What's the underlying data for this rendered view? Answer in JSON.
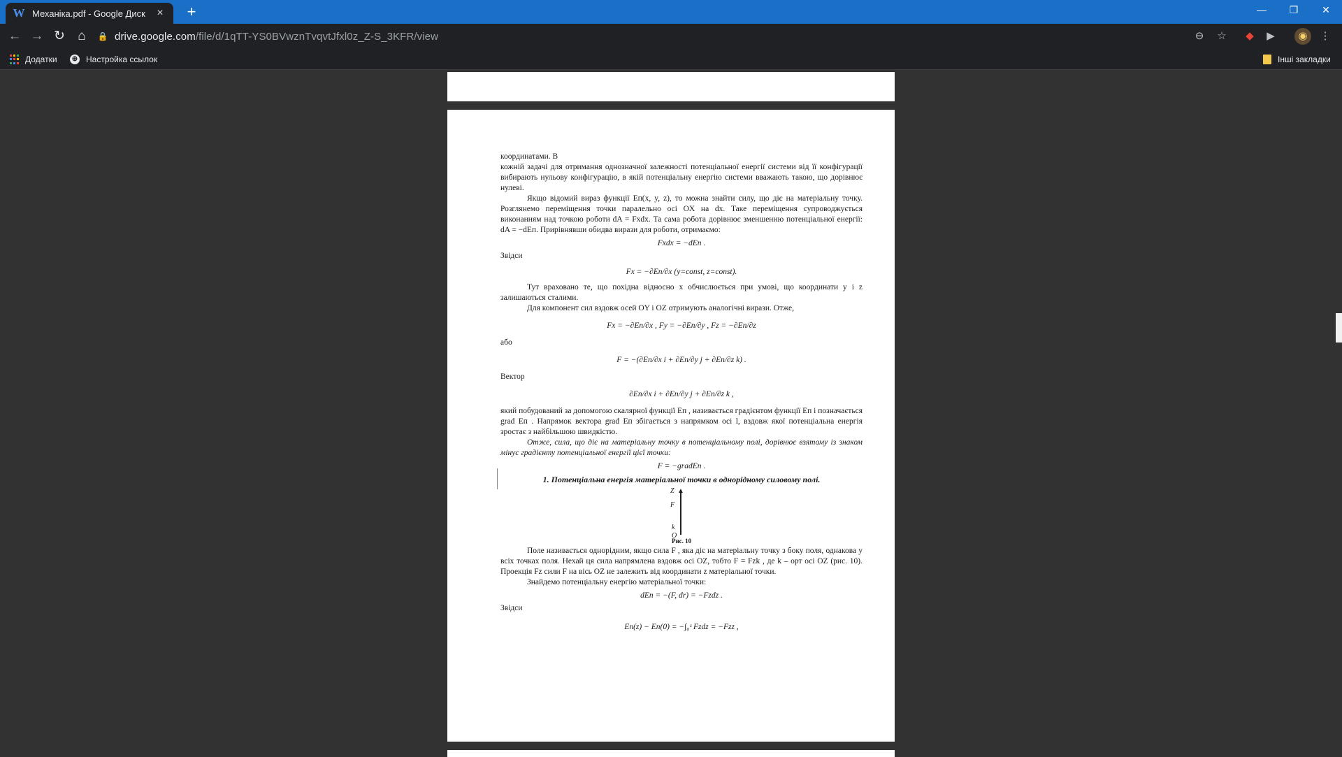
{
  "browser": {
    "tab_title": "Механіка.pdf - Google Диск",
    "tab_favicon": "W",
    "new_tab": "+",
    "url_host": "drive.google.com",
    "url_path": "/file/d/1qTT-YS0BVwznTvqvtJfxl0z_Z-S_3KFR/view",
    "window_controls": {
      "minimize": "—",
      "restore": "❐",
      "close": "✕"
    }
  },
  "bookmarks": {
    "apps": "Додатки",
    "link_settings": "Настройка ссылок",
    "other": "Інші закладки"
  },
  "pdf": {
    "paragraphs": [
      "координатами. В",
      "кожній задачі для отримання однозначної залежності потенціальної енергії системи від її конфігурації вибирають нульову конфігурацію, в якій потенціальну енергію системи вважають такою, що дорівнює нулеві.",
      "Якщо відомий вираз функції Eп(x, y, z), то можна знайти силу, що діє на матеріальну точку. Розглянемо переміщення точки паралельно осі OX на dx. Таке переміщення супроводжується виконанням над точкою роботи dA = Fxdx. Та сама робота дорівнює зменшенню потенціальної енергії: dA = −dEп. Прирівнявши обидва вирази для роботи, отримаємо:",
      "Fxdx = −dEп .",
      "Звідси",
      "Fx = −∂Eп/∂x      (y=const, z=const).",
      "Тут враховано те, що похідна відносно x обчислюється при умові, що координати y і z залишаються сталими.",
      "Для компонент сил вздовж осей OY і OZ отримують аналогічні вирази. Отже,",
      "Fx = −∂Eп/∂x ,  Fy = −∂Eп/∂y ,  Fz = −∂Eп/∂z",
      "або",
      "F = −(∂Eп/∂x i + ∂Eп/∂y j + ∂Eп/∂z k) .",
      "Вектор",
      "∂Eп/∂x i + ∂Eп/∂y j + ∂Eп/∂z k ,",
      "який побудований за допомогою скалярної функції Eп , називається градієнтом функції Eп і позначається grad Eп . Напрямок вектора grad Eп збігається з напрямком осі l, вздовж якої потенціальна енергія зростає з найбільшою швидкістю.",
      "Отже, сила, що діє на матеріальну точку в потенціальному полі, дорівнює взятому із знаком мінус градієнту потенціальної енергії цієї точки:",
      "F = −gradEп .",
      "1. Потенціальна енергія матеріальної точки в однорідному силовому полі.",
      "Поле називається однорідним, якщо сила F , яка діє на матеріальну точку з боку поля, однакова у всіх точках поля. Нехай ця сила напрямлена вздовж осі OZ, тобто F = Fzk , де k – орт осі OZ (рис. 10). Проекція Fz сили F на вісь OZ не залежить від координати z матеріальної точки.",
      "Знайдемо потенціальну енергію матеріальної точки:",
      "dEп = −(F, dr) = −Fzdz .",
      "Звідси",
      "Eп(z) − Eп(0) = −∫₀ᶻ Fzdz = −Fzz ,"
    ],
    "figure": {
      "z": "Z",
      "f": "F",
      "k": "k",
      "o": "O",
      "caption": "Рис. 10"
    }
  }
}
